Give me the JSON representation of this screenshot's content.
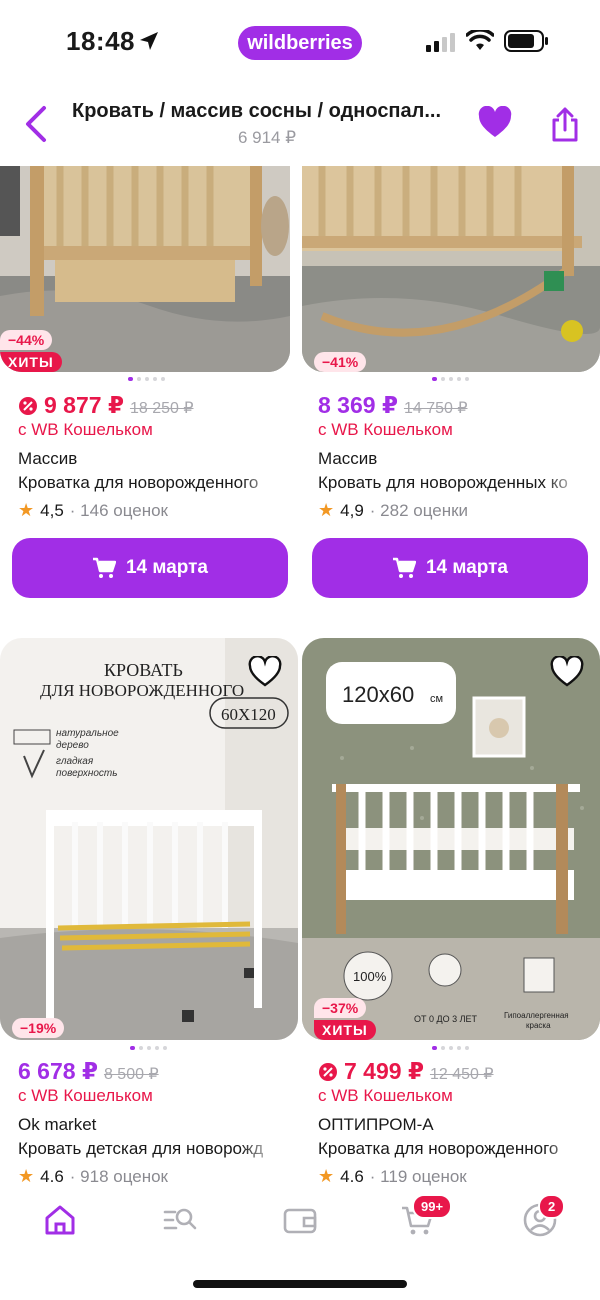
{
  "status_bar": {
    "time": "18:48",
    "app_pill": "wildberries"
  },
  "header": {
    "title": "Кровать / массив сосны / односпал...",
    "subtitle": "6 914 ₽"
  },
  "products": [
    {
      "discount": "−44%",
      "hit": "ХИТЫ",
      "price": "9 877 ₽",
      "old_price": "18 250 ₽",
      "wallet": "с WB Кошельком",
      "brand": "Массив",
      "name": "Кроватка для новорожденного",
      "rating": "4,5",
      "reviews": "· 146 оценок",
      "button": "14 марта"
    },
    {
      "discount": "−41%",
      "price": "8 369 ₽",
      "old_price": "14 750 ₽",
      "wallet": "с WB Кошельком",
      "brand": "Массив",
      "name": "Кровать для новорожденных ко",
      "rating": "4,9",
      "reviews": "· 282 оценки",
      "button": "14 марта"
    },
    {
      "discount": "−19%",
      "price": "6 678 ₽",
      "old_price": "8 500 ₽",
      "wallet": "с WB Кошельком",
      "brand": "Ok market",
      "name": "Кровать детская для новорожд",
      "rating": "4.6",
      "reviews": "· 918 оценок",
      "image_text": {
        "line1": "КРОВАТЬ",
        "line2": "ДЛЯ НОВОРОЖДЕННОГО",
        "size": "60Х120",
        "feat1a": "натуральное",
        "feat1b": "дерево",
        "feat2a": "гладкая",
        "feat2b": "поверхность"
      }
    },
    {
      "discount": "−37%",
      "hit": "ХИТЫ",
      "price": "7 499 ₽",
      "old_price": "12 450 ₽",
      "wallet": "с WB Кошельком",
      "brand": "ОПТИПРОМ-А",
      "name": "Кроватка для новорожденного",
      "rating": "4.6",
      "reviews": "· 119 оценок",
      "image_text": {
        "size": "120х60",
        "unit": "см",
        "b1": "100%",
        "b2": "ОТ 0 ДО 3 ЛЕТ",
        "b3a": "Гипоаллергенная",
        "b3b": "краска"
      }
    }
  ],
  "bottom_nav": {
    "cart_badge": "99+",
    "profile_badge": "2"
  },
  "colors": {
    "accent": "#a12ee6",
    "sale": "#e8174a",
    "star": "#f29824"
  }
}
